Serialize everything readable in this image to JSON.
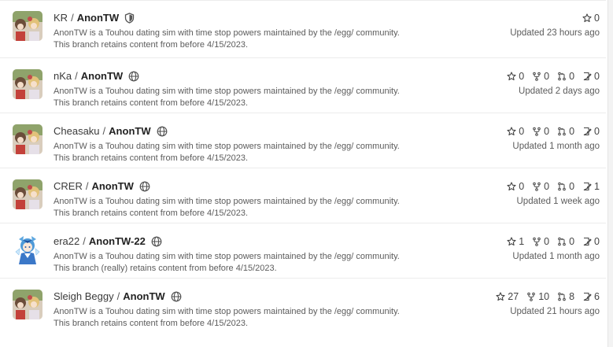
{
  "repos": [
    {
      "owner": "KR",
      "name": "AnonTW",
      "visibility": "private-shield-icon",
      "avatar": "touhou-group",
      "desc1": "AnonTW is a Touhou dating sim with time stop powers maintained by the /egg/ community.",
      "desc2": "This branch retains content from before 4/15/2023.",
      "stars": "0",
      "forks": "",
      "prs": "",
      "issues": "",
      "updated": "Updated 23 hours ago"
    },
    {
      "owner": "nKa",
      "name": "AnonTW",
      "visibility": "globe-icon",
      "avatar": "touhou-group",
      "desc1": "AnonTW is a Touhou dating sim with time stop powers maintained by the /egg/ community.",
      "desc2": "This branch retains content from before 4/15/2023.",
      "stars": "0",
      "forks": "0",
      "prs": "0",
      "issues": "0",
      "updated": "Updated 2 days ago"
    },
    {
      "owner": "Cheasaku",
      "name": "AnonTW",
      "visibility": "globe-icon",
      "avatar": "touhou-group",
      "desc1": "AnonTW is a Touhou dating sim with time stop powers maintained by the /egg/ community.",
      "desc2": "This branch retains content from before 4/15/2023.",
      "stars": "0",
      "forks": "0",
      "prs": "0",
      "issues": "0",
      "updated": "Updated 1 month ago"
    },
    {
      "owner": "CRER",
      "name": "AnonTW",
      "visibility": "globe-icon",
      "avatar": "touhou-group",
      "desc1": "AnonTW is a Touhou dating sim with time stop powers maintained by the /egg/ community.",
      "desc2": "This branch retains content from before 4/15/2023.",
      "stars": "0",
      "forks": "0",
      "prs": "0",
      "issues": "1",
      "updated": "Updated 1 week ago"
    },
    {
      "owner": "era22",
      "name": "AnonTW-22",
      "visibility": "globe-icon",
      "avatar": "cirno",
      "desc1": "AnonTW is a Touhou dating sim with time stop powers maintained by the /egg/ community.",
      "desc2": "This branch (really) retains content from before 4/15/2023.",
      "stars": "1",
      "forks": "0",
      "prs": "0",
      "issues": "0",
      "updated": "Updated 1 month ago"
    },
    {
      "owner": "Sleigh Beggy",
      "name": "AnonTW",
      "visibility": "globe-icon",
      "avatar": "touhou-group",
      "desc1": "AnonTW is a Touhou dating sim with time stop powers maintained by the /egg/ community.",
      "desc2": "This branch retains content from before 4/15/2023.",
      "stars": "27",
      "forks": "10",
      "prs": "8",
      "issues": "6",
      "updated": "Updated 21 hours ago"
    }
  ],
  "separator": "/"
}
